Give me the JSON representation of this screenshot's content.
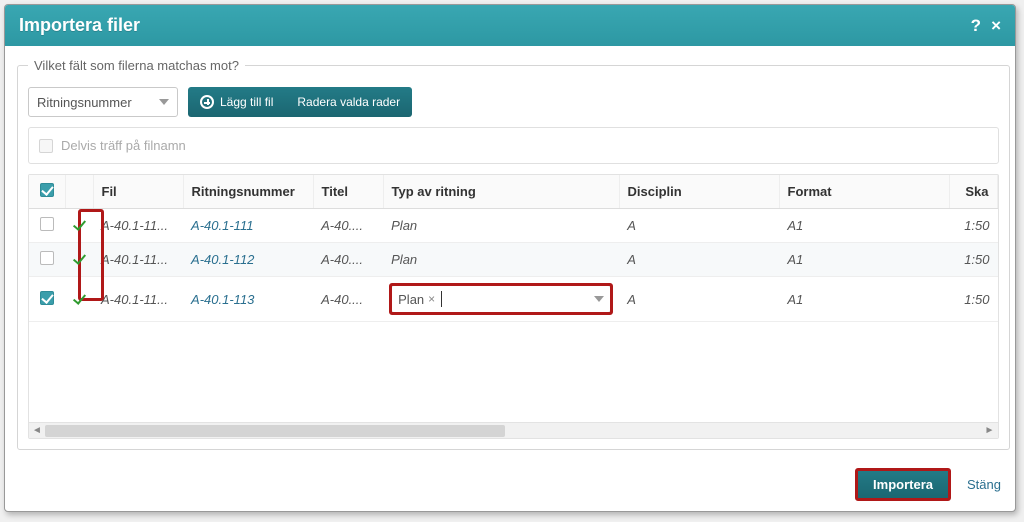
{
  "dialog": {
    "title": "Importera filer",
    "help": "?",
    "close": "×"
  },
  "fieldset": {
    "legend": "Vilket fält som filerna matchas mot?"
  },
  "select": {
    "value": "Ritningsnummer"
  },
  "toolbar": {
    "add_file": "Lägg till fil",
    "delete_rows": "Radera valda rader"
  },
  "filter": {
    "label": "Delvis träff på filnamn"
  },
  "table": {
    "headers": {
      "fil": "Fil",
      "ritningsnummer": "Ritningsnummer",
      "titel": "Titel",
      "typ": "Typ av ritning",
      "disciplin": "Disciplin",
      "format": "Format",
      "ska": "Ska"
    },
    "rows": [
      {
        "checked": false,
        "fil": "A-40.1-11...",
        "ritn": "A-40.1-111",
        "titel": "A-40....",
        "typ": "Plan",
        "disc": "A",
        "format": "A1",
        "ska": "1:50"
      },
      {
        "checked": false,
        "fil": "A-40.1-11...",
        "ritn": "A-40.1-112",
        "titel": "A-40....",
        "typ": "Plan",
        "disc": "A",
        "format": "A1",
        "ska": "1:50"
      },
      {
        "checked": true,
        "fil": "A-40.1-11...",
        "ritn": "A-40.1-113",
        "titel": "A-40....",
        "typ": "Plan",
        "disc": "A",
        "format": "A1",
        "ska": "1:50"
      }
    ],
    "editing": {
      "tag": "Plan"
    }
  },
  "footer": {
    "import": "Importera",
    "close": "Stäng"
  }
}
